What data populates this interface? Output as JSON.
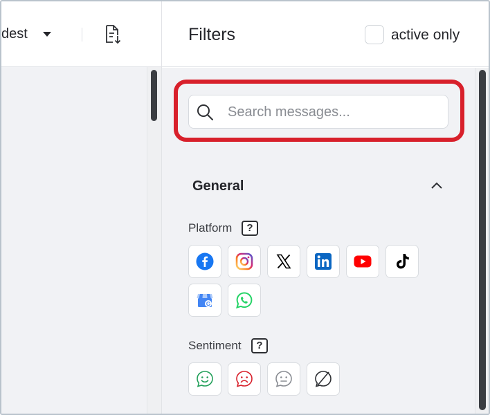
{
  "left_header": {
    "sort_value": "dest",
    "sort_caret_icon": "caret-down-icon",
    "export_icon": "document-export-icon"
  },
  "filters": {
    "title": "Filters",
    "active_only_label": "active only",
    "active_only_checked": false,
    "search": {
      "placeholder": "Search messages...",
      "value": "",
      "icon": "search-icon"
    },
    "highlight_color": "#d8202b",
    "general": {
      "title": "General",
      "expanded": true,
      "platform": {
        "label": "Platform",
        "help": "?",
        "items": [
          {
            "name": "facebook",
            "icon": "facebook-icon",
            "color": "#1877f2"
          },
          {
            "name": "instagram",
            "icon": "instagram-icon",
            "color": "#dd2a7b"
          },
          {
            "name": "x",
            "icon": "x-icon",
            "color": "#000000"
          },
          {
            "name": "linkedin",
            "icon": "linkedin-icon",
            "color": "#0a66c2"
          },
          {
            "name": "youtube",
            "icon": "youtube-icon",
            "color": "#ff0000"
          },
          {
            "name": "tiktok",
            "icon": "tiktok-icon",
            "color": "#000000"
          },
          {
            "name": "google-business",
            "icon": "google-business-icon",
            "color": "#4285f4"
          },
          {
            "name": "whatsapp",
            "icon": "whatsapp-icon",
            "color": "#25d366"
          }
        ]
      },
      "sentiment": {
        "label": "Sentiment",
        "help": "?",
        "items": [
          {
            "name": "positive",
            "icon": "smile-face-icon",
            "color": "#23a05a"
          },
          {
            "name": "negative",
            "icon": "sad-face-icon",
            "color": "#d8202b"
          },
          {
            "name": "neutral",
            "icon": "neutral-face-icon",
            "color": "#8a8d93"
          },
          {
            "name": "none",
            "icon": "no-sentiment-icon",
            "color": "#2d2f33"
          }
        ]
      }
    }
  }
}
